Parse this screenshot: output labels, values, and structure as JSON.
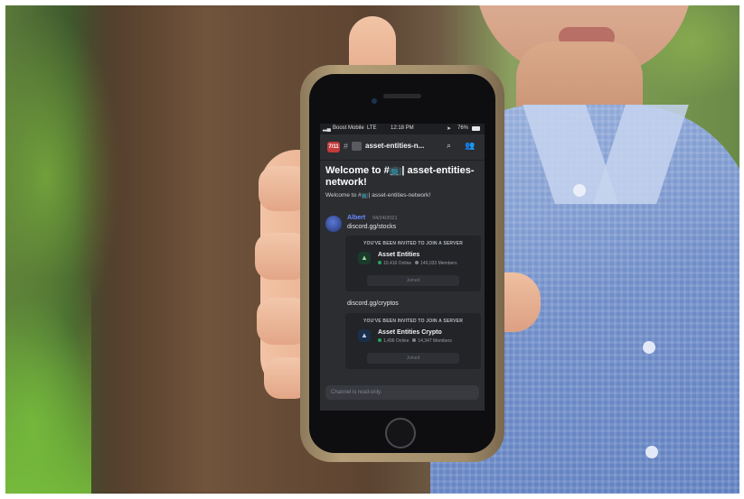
{
  "status_bar": {
    "carrier": "Boost Mobile",
    "network": "LTE",
    "time": "12:18 PM",
    "battery": "76%"
  },
  "channel_header": {
    "server_badge": "7/11",
    "channel_name": "asset-entities-n...",
    "icons": [
      "search-icon",
      "members-icon"
    ]
  },
  "welcome": {
    "title": "Welcome to #📺| asset-entities-network!",
    "subtitle": "Welcome to #📺| asset-entities-network!"
  },
  "messages": [
    {
      "author": "Albert",
      "date": "04/24/2021",
      "text": "discord.gg/stocks",
      "invite": {
        "header": "YOU'VE BEEN INVITED TO JOIN A SERVER",
        "server_name": "Asset Entities",
        "online": "10,416 Online",
        "members": "146,033 Members",
        "button": "Joined"
      }
    },
    {
      "text": "discord.gg/cryptos",
      "invite": {
        "header": "YOU'VE BEEN INVITED TO JOIN A SERVER",
        "server_name": "Asset Entities Crypto",
        "online": "1,496 Online",
        "members": "14,347 Members",
        "button": "Joined"
      }
    }
  ],
  "composer": {
    "placeholder": "Channel is read-only."
  },
  "colors": {
    "discord_bg": "#2b2d31",
    "author_blue": "#6b8cff",
    "online_green": "#23a55a",
    "shirt_blue": "#6f8dc8"
  }
}
